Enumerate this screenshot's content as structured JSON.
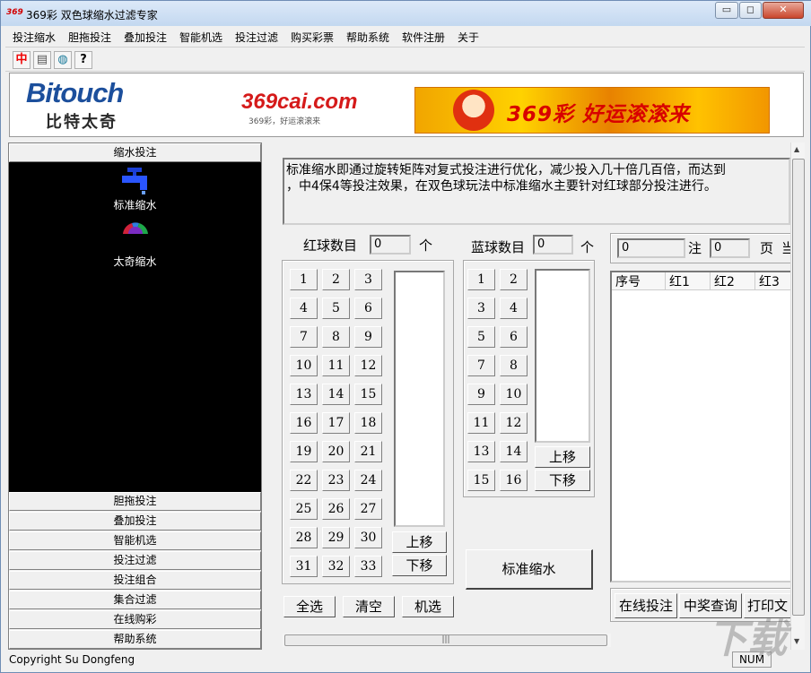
{
  "window": {
    "icon_text": "369",
    "title": "369彩 双色球缩水过滤专家",
    "minimize": "▭",
    "restore": "◻",
    "close": "✕"
  },
  "menu": [
    "投注缩水",
    "胆拖投注",
    "叠加投注",
    "智能机选",
    "投注过滤",
    "购买彩票",
    "帮助系统",
    "软件注册",
    "关于"
  ],
  "toolbar": [
    {
      "icon": "china-flag-icon",
      "glyph": "中"
    },
    {
      "icon": "save-icon",
      "glyph": "▤"
    },
    {
      "icon": "globe-icon",
      "glyph": "◍"
    },
    {
      "icon": "help-icon",
      "glyph": "?"
    }
  ],
  "banner": {
    "brand": "Bitouch",
    "brand_cn": "比特太奇",
    "site_logo": "369cai.com",
    "site_slogan": "369彩，好运滚滚来",
    "ad_text": "369彩  好运滚滚来"
  },
  "sidebar": {
    "header": "缩水投注",
    "items": [
      {
        "label": "标准缩水",
        "icon": "faucet-icon"
      },
      {
        "label": "太奇缩水",
        "icon": "fan-icon"
      }
    ],
    "sections": [
      "胆拖投注",
      "叠加投注",
      "智能机选",
      "投注过滤",
      "投注组合",
      "集合过滤",
      "在线购彩",
      "帮助系统"
    ]
  },
  "main": {
    "description_lines": [
      "标准缩水即通过旋转矩阵对复式投注进行优化，减少投入几十倍几百倍，而达到",
      "，中4保4等投注效果，在双色球玩法中标准缩水主要针对红球部分投注进行。"
    ],
    "red": {
      "label": "红球数目",
      "count": "0",
      "unit": "个",
      "numbers": [
        "1",
        "2",
        "3",
        "4",
        "5",
        "6",
        "7",
        "8",
        "9",
        "10",
        "11",
        "12",
        "13",
        "14",
        "15",
        "16",
        "17",
        "18",
        "19",
        "20",
        "21",
        "22",
        "23",
        "24",
        "25",
        "26",
        "27",
        "28",
        "29",
        "30",
        "31",
        "32",
        "33"
      ],
      "up": "上移",
      "down": "下移"
    },
    "blue": {
      "label": "蓝球数目",
      "count": "0",
      "unit": "个",
      "numbers": [
        "1",
        "2",
        "3",
        "4",
        "5",
        "6",
        "7",
        "8",
        "9",
        "10",
        "11",
        "12",
        "13",
        "14",
        "15",
        "16"
      ],
      "up": "上移",
      "down": "下移"
    },
    "buttons": {
      "select_all": "全选",
      "clear": "清空",
      "random": "机选",
      "standard_reduce": "标准缩水"
    },
    "results": {
      "bets": "0",
      "bets_unit": "注",
      "page": "0",
      "page_unit": "页",
      "page_suffix": "当",
      "columns": [
        "序号",
        "红1",
        "红2",
        "红3"
      ],
      "online_bet": "在线投注",
      "prize_query": "中奖查询",
      "print": "打印文"
    }
  },
  "statusbar": {
    "copyright": "Copyright Su Dongfeng",
    "numlock": "NUM"
  }
}
